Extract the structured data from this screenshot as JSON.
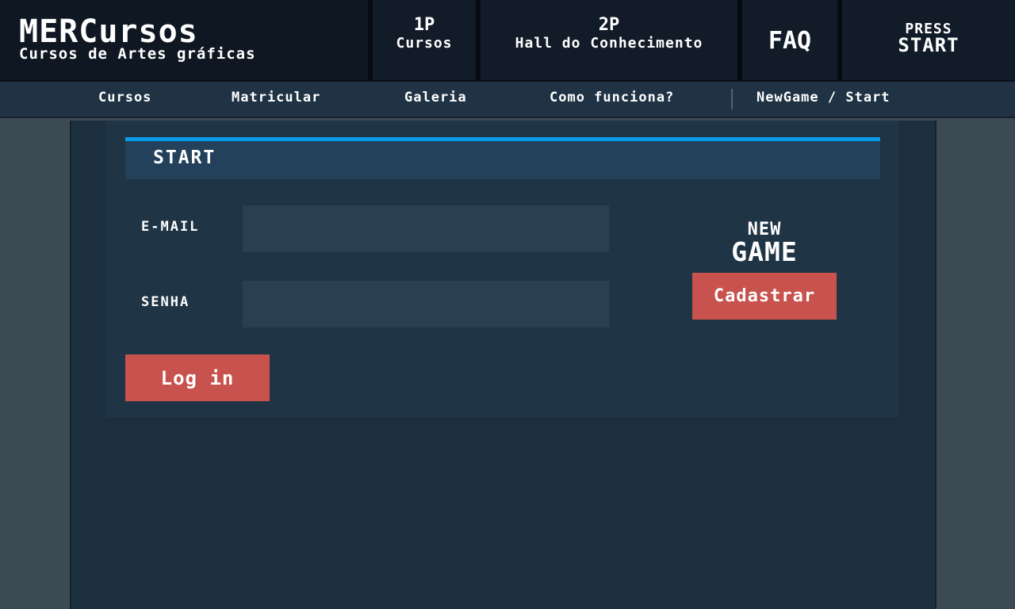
{
  "header": {
    "brand_title": "MERCursos",
    "brand_subtitle": "Cursos de Artes gráficas",
    "nav": {
      "p1_big": "1P",
      "p1_small": "Cursos",
      "p2_big": "2P",
      "p2_small": "Hall do Conhecimento",
      "faq": "FAQ",
      "press": "PRESS",
      "start": "START"
    }
  },
  "subnav": {
    "items": [
      {
        "label": "Cursos"
      },
      {
        "label": "Matricular"
      },
      {
        "label": "Galeria"
      },
      {
        "label": "Como funciona?"
      },
      {
        "label": "NewGame / Start"
      }
    ]
  },
  "login": {
    "title": "START",
    "email_label": "E-MAIL",
    "email_value": "",
    "password_label": "SENHA",
    "password_value": "",
    "login_button": "Log in"
  },
  "signup": {
    "heading_line1": "NEW",
    "heading_line2": "GAME",
    "button": "Cadastrar"
  },
  "colors": {
    "header_bg": "#0e1722",
    "subnav_bg": "#1f3344",
    "panel_bg": "#1c2f3e",
    "accent_blue": "#0a9be8",
    "button_red": "#c8524d",
    "input_bg": "#2a4052"
  }
}
